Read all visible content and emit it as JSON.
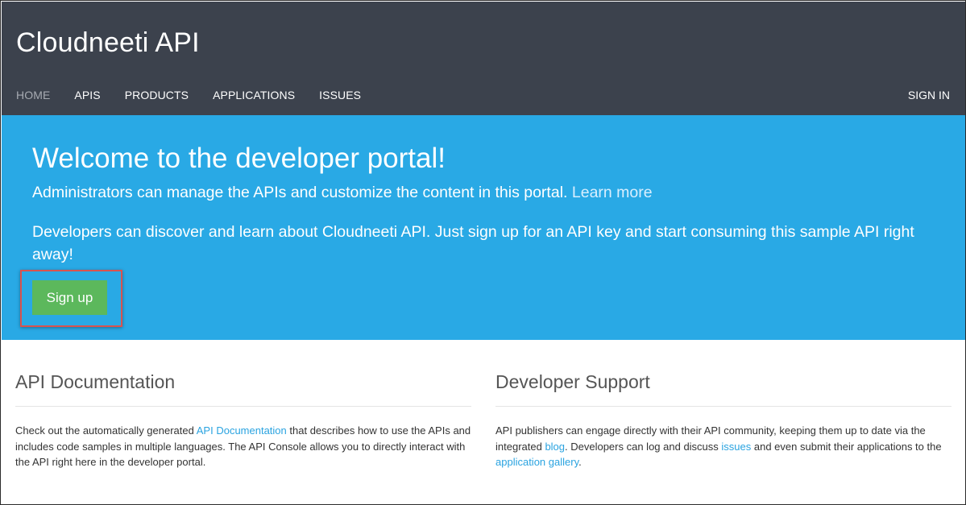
{
  "header": {
    "site_title": "Cloudneeti API",
    "nav": [
      {
        "label": "HOME"
      },
      {
        "label": "APIS"
      },
      {
        "label": "PRODUCTS"
      },
      {
        "label": "APPLICATIONS"
      },
      {
        "label": "ISSUES"
      }
    ],
    "sign_in": "SIGN IN"
  },
  "hero": {
    "title": "Welcome to the developer portal!",
    "admin_text": "Administrators can manage the APIs and customize the content in this portal.",
    "learn_more": "Learn more",
    "dev_text": "Developers can discover and learn about Cloudneeti API. Just sign up for an API key and start consuming this sample API right away!",
    "signup_label": "Sign up"
  },
  "columns": {
    "api_docs": {
      "title": "API Documentation",
      "text_before": "Check out the automatically generated ",
      "link": "API Documentation",
      "text_after": " that describes how to use the APIs and includes code samples in multiple languages. The API Console allows you to directly interact with the API right here in the developer portal."
    },
    "support": {
      "title": "Developer Support",
      "text_1": "API publishers can engage directly with their API community, keeping them up to date via the integrated ",
      "link_blog": "blog",
      "text_2": ". Developers can log and discuss ",
      "link_issues": "issues",
      "text_3": " and even submit their applications to the ",
      "link_gallery": "application gallery",
      "text_4": "."
    }
  },
  "colors": {
    "header_bg": "#3c424d",
    "hero_bg": "#29a9e5",
    "signup_green": "#5cb85c",
    "highlight_red": "#d9534f",
    "link_blue": "#2aa3e0"
  }
}
